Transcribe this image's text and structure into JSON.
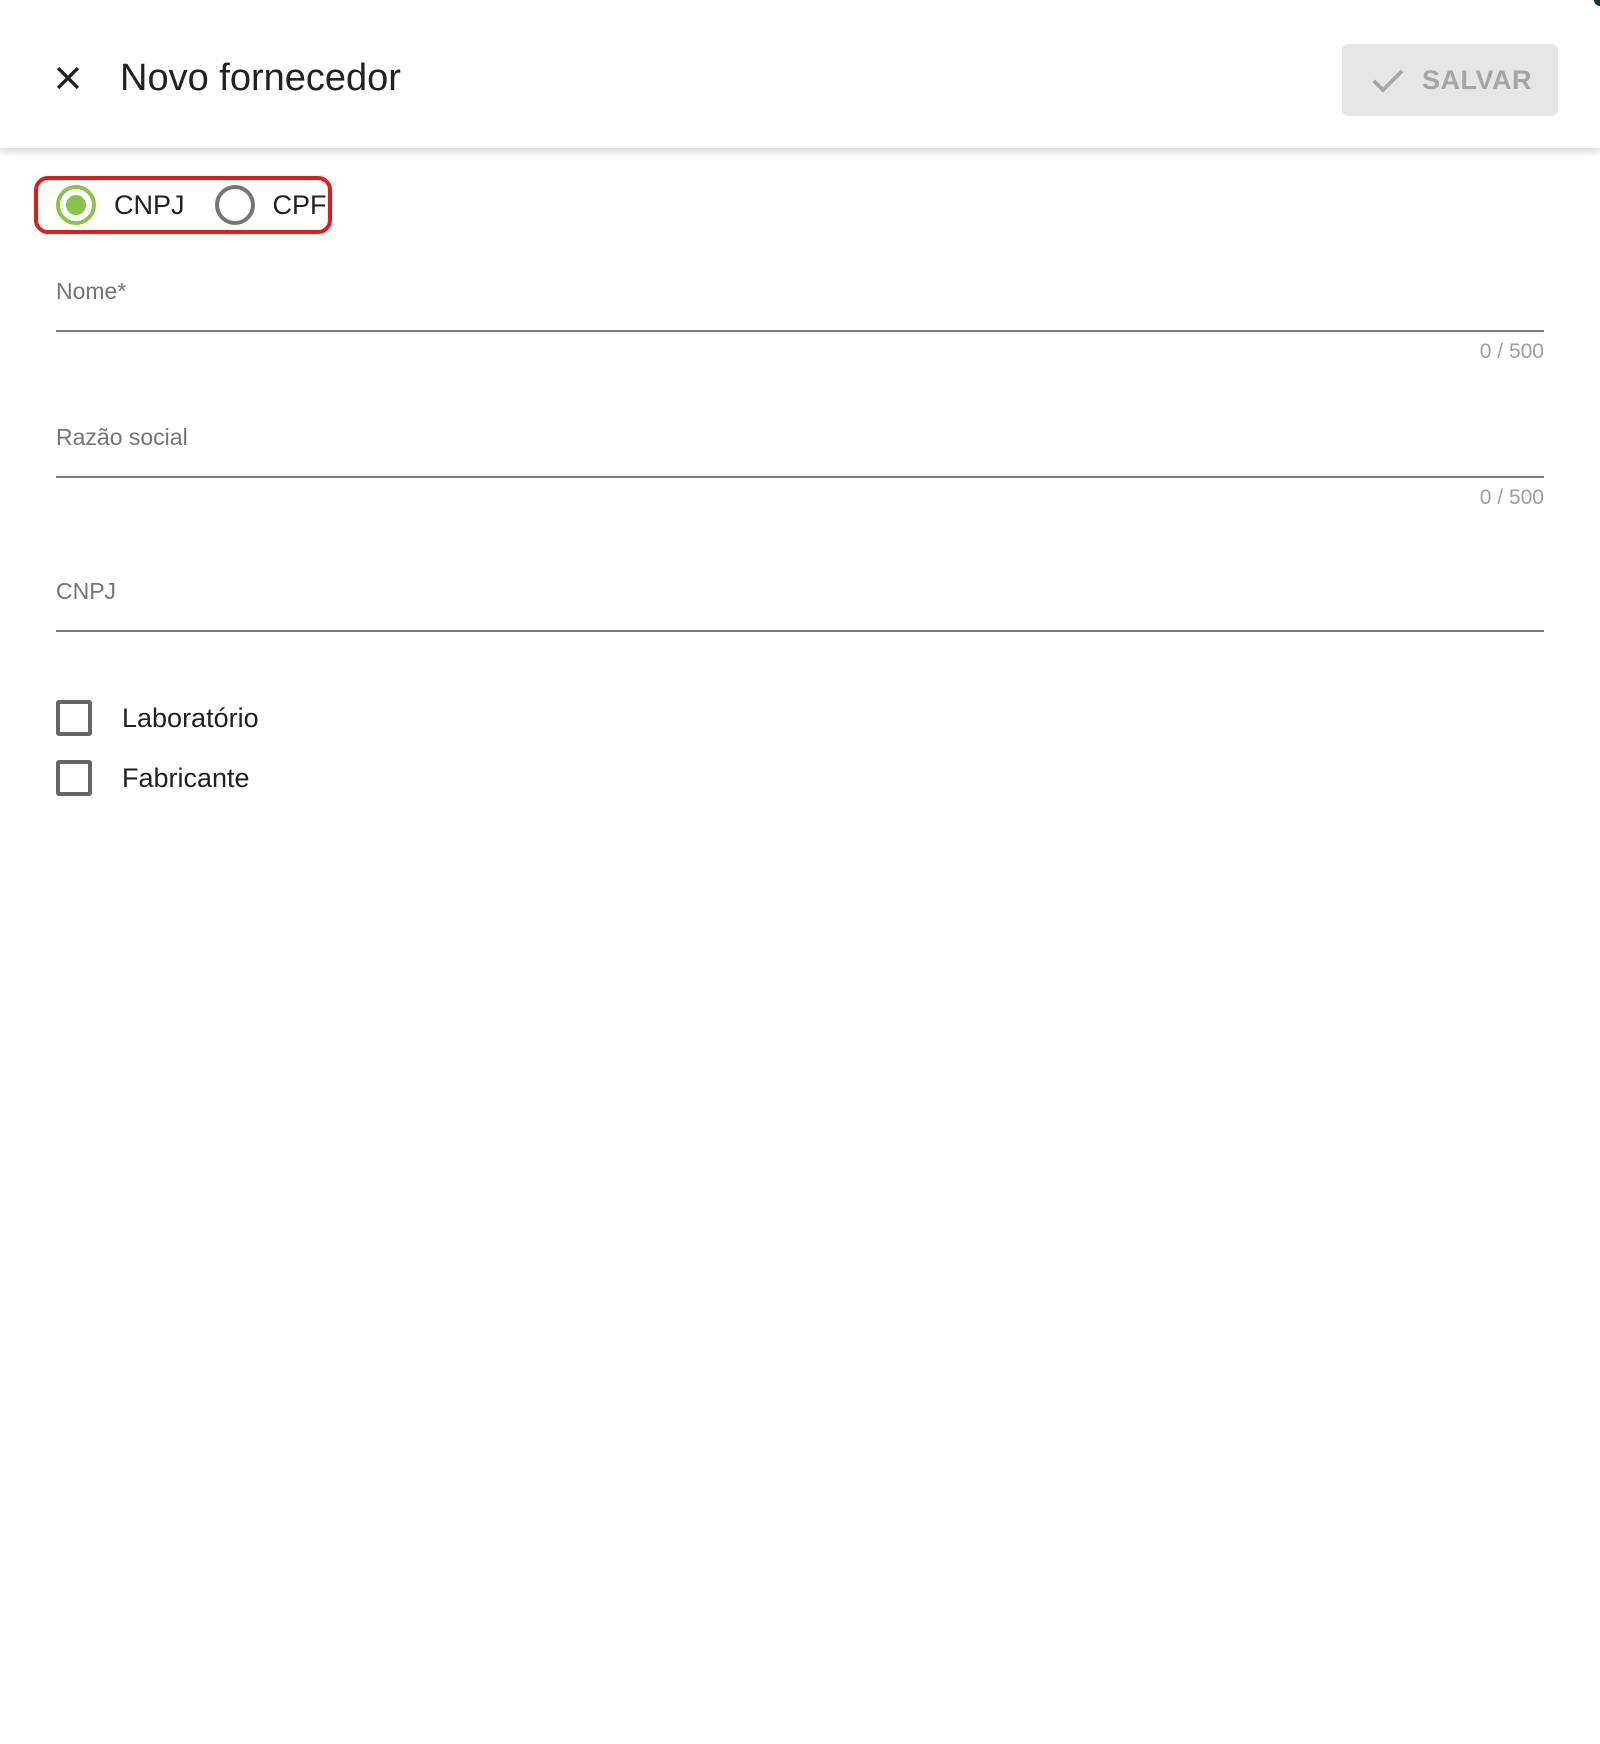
{
  "header": {
    "title": "Novo fornecedor",
    "save_label": "SALVAR",
    "close_icon": "close-icon",
    "save_icon": "check-icon"
  },
  "document_type": {
    "selected": "CNPJ",
    "options": [
      {
        "label": "CNPJ",
        "checked": true
      },
      {
        "label": "CPF",
        "checked": false
      }
    ]
  },
  "fields": {
    "nome": {
      "label": "Nome*",
      "value": "",
      "counter": "0 / 500"
    },
    "razao_social": {
      "label": "Razão social",
      "value": "",
      "counter": "0 / 500"
    },
    "cnpj": {
      "label": "CNPJ",
      "value": ""
    }
  },
  "checkboxes": [
    {
      "label": "Laboratório",
      "checked": false
    },
    {
      "label": "Fabricante",
      "checked": false
    }
  ],
  "colors": {
    "accent": "#8bc34a",
    "highlight_border": "#e11a1a",
    "disabled_button_bg": "#e6e6e6",
    "disabled_text": "#a6a6a6"
  }
}
